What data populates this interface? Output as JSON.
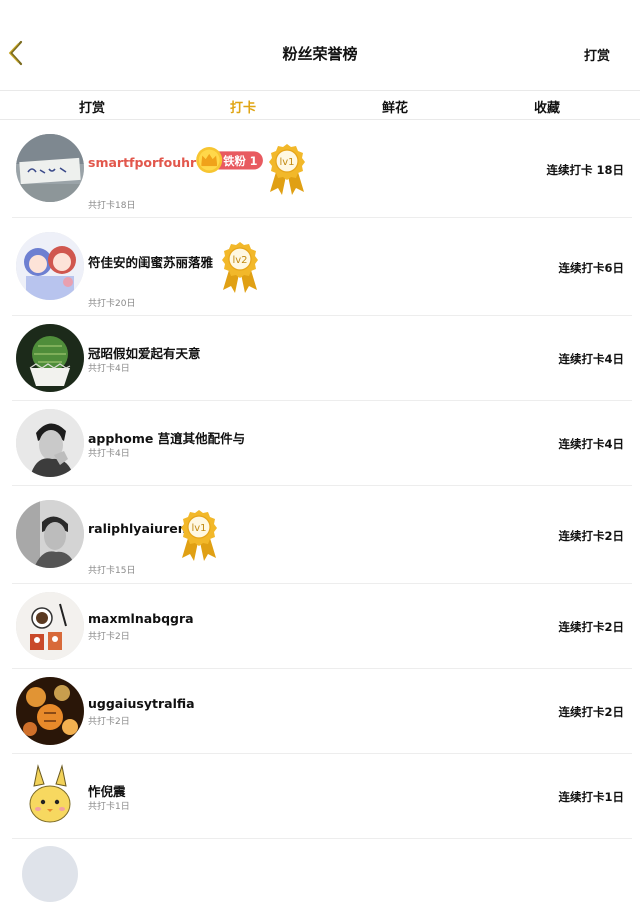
{
  "header": {
    "title": "粉丝荣誉榜",
    "right_action": "打赏"
  },
  "tabs": [
    {
      "label": "打赏",
      "active": false
    },
    {
      "label": "打卡",
      "active": true
    },
    {
      "label": "鲜花",
      "active": false
    },
    {
      "label": "收藏",
      "active": false
    }
  ],
  "colors": {
    "accent": "#e0a514",
    "highlight_name": "#e2574c",
    "fan_badge": "#e85a60",
    "medal_gold": "#f2b82a"
  },
  "rows": [
    {
      "name": "smartfporfouhr",
      "sub": "共打卡18日",
      "streak": "连续打卡 18日",
      "fan_badge": "铁粉 1",
      "medal": "lv1",
      "avatar_icon": "handwriting-note-avatar"
    },
    {
      "name": "符佳安的闺蜜苏丽落雅",
      "sub": "共打卡20日",
      "streak": "连续打卡6日",
      "medal": "lv2",
      "avatar_icon": "anime-girls-avatar"
    },
    {
      "name": "冠昭假如爱起有天意",
      "sub": "共打卡4日",
      "streak": "连续打卡4日",
      "avatar_icon": "cactus-avatar"
    },
    {
      "name": "apphome 莒逳其他配件与",
      "sub": "共打卡4日",
      "streak": "连续打卡4日",
      "avatar_icon": "man-portrait-avatar"
    },
    {
      "name": "raliphlyaiurend",
      "sub": "共打卡15日",
      "streak": "连续打卡2日",
      "medal": "lv1",
      "avatar_icon": "bw-portrait-avatar"
    },
    {
      "name": "maxmlnabqgra",
      "sub": "共打卡2日",
      "streak": "连续打卡2日",
      "avatar_icon": "coffee-cups-avatar"
    },
    {
      "name": "uggaiusytralfia",
      "sub": "共打卡2日",
      "streak": "连续打卡2日",
      "avatar_icon": "lanterns-avatar"
    },
    {
      "name": "怍倪震",
      "sub": "共打卡1日",
      "streak": "连续打卡1日",
      "avatar_icon": "cartoon-chick-avatar"
    }
  ]
}
